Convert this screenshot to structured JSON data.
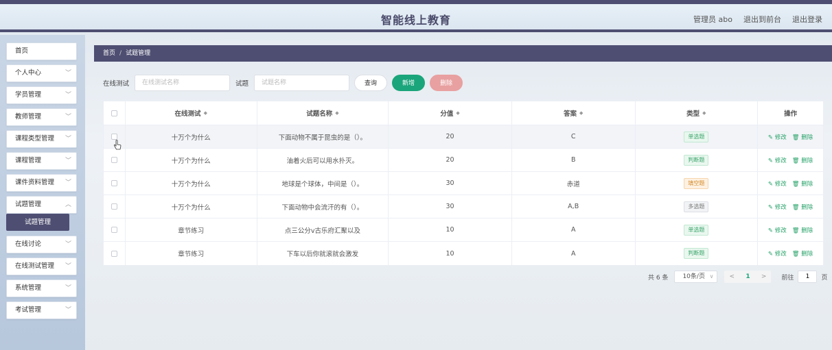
{
  "header": {
    "title": "智能线上教育",
    "links": [
      "管理员 abo",
      "退出到前台",
      "退出登录"
    ]
  },
  "sidebar": {
    "items": [
      "首页",
      "个人中心",
      "学员管理",
      "教师管理",
      "课程类型管理",
      "课程管理",
      "课件资料管理",
      "试题管理",
      "在线讨论",
      "在线测试管理",
      "系统管理",
      "考试管理"
    ],
    "active_sub": "试题管理"
  },
  "breadcrumb": {
    "home": "首页",
    "separator": "/",
    "current": "试题管理"
  },
  "search": {
    "test_label": "在线测试",
    "test_placeholder": "在线测试名称",
    "question_label": "试题",
    "question_placeholder": "试题名称",
    "query_btn": "查询",
    "add_btn": "新增",
    "delete_btn": "删除"
  },
  "table": {
    "headers": [
      "在线测试",
      "试题名称",
      "分值",
      "答案",
      "类型",
      "操作"
    ],
    "edit_label": "修改",
    "delete_label": "删除",
    "rows": [
      {
        "test": "十万个为什么",
        "question": "下面动物不属于昆虫的是（）。",
        "score": "20",
        "answer": "C",
        "type": "单选题"
      },
      {
        "test": "十万个为什么",
        "question": "油着火后可以用水扑灭。",
        "score": "20",
        "answer": "B",
        "type": "判断题"
      },
      {
        "test": "十万个为什么",
        "question": "地球是个球体，中间是（）。",
        "score": "30",
        "answer": "赤道",
        "type": "填空题"
      },
      {
        "test": "十万个为什么",
        "question": "下面动物中会流汗的有（）。",
        "score": "30",
        "answer": "A,B",
        "type": "多选题"
      },
      {
        "test": "章节练习",
        "question": "点三公分v古乐府汇聚以及",
        "score": "10",
        "answer": "A",
        "type": "单选题"
      },
      {
        "test": "章节练习",
        "question": "下车以后你就滚就会激发",
        "score": "10",
        "answer": "A",
        "type": "判断题"
      }
    ]
  },
  "pagination": {
    "total": "共 6 条",
    "page_size": "10条/页",
    "prev": "<",
    "current_page": "1",
    "next": ">",
    "goto_label": "前往",
    "goto_value": "1",
    "page_suffix": "页"
  }
}
